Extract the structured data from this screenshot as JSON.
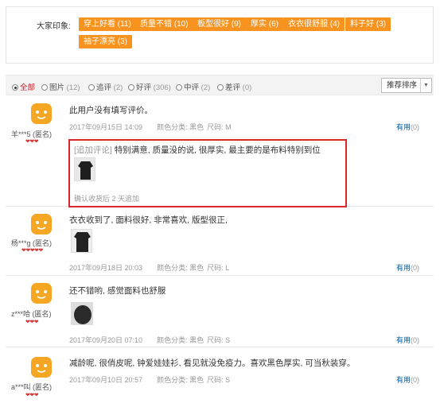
{
  "impressions": {
    "title": "大家印象:",
    "tags": [
      "穿上好看 (11)",
      "质量不错 (10)",
      "板型很好 (9)",
      "厚实 (6)",
      "衣衣很舒服 (4)",
      "料子好 (3)",
      "袖子漂亮 (3)"
    ]
  },
  "filter": {
    "options": [
      {
        "label": "全部",
        "count": ""
      },
      {
        "label": "图片",
        "count": "(12)"
      },
      {
        "label": "追评",
        "count": "(2)"
      },
      {
        "label": "好评",
        "count": "(306)"
      },
      {
        "label": "中评",
        "count": "(2)"
      },
      {
        "label": "差评",
        "count": "(0)"
      }
    ],
    "sort_label": "推荐排序",
    "sort_caret": "▼"
  },
  "reviews": [
    {
      "user": "羊***5 (匿名)",
      "hearts": "❤❤❤",
      "content": "此用户没有填写评价。",
      "date": "2017年09月15日 14:09",
      "color": "颜色分类: 黑色",
      "size": "尺码: M",
      "useful": "有用",
      "useful_count": "(0)",
      "append": {
        "tag": "[追加评论]",
        "text": "特别满意, 质量没的说, 很厚实, 最主要的是布料特别到位",
        "note": "确认收货后 2 天追加"
      }
    },
    {
      "user": "杨***g (匿名)",
      "hearts": "❤❤❤❤❤",
      "content": "衣衣收到了, 面料很好, 非常喜欢, 版型很正,",
      "date": "2017年09月18日 20:03",
      "color": "颜色分类: 黑色",
      "size": "尺码: L",
      "useful": "有用",
      "useful_count": "(0)"
    },
    {
      "user": "z***哈 (匿名)",
      "hearts": "❤❤❤",
      "content": "还不错哟, 感觉面料也舒服",
      "date": "2017年09月20日 07:10",
      "color": "颜色分类: 黑色",
      "size": "尺码: S",
      "useful": "有用",
      "useful_count": "(0)"
    },
    {
      "user": "a***叫 (匿名)",
      "hearts": "❤❤❤",
      "content": "减龄呢, 很俏皮呢, 钟爱娃娃衫, 看见就没免疫力。喜欢黑色厚实, 可当秋装穿。",
      "date": "2017年09月10日 20:57",
      "color": "颜色分类: 黑色",
      "size": "尺码: S",
      "useful": "有用",
      "useful_count": "(0)"
    }
  ]
}
